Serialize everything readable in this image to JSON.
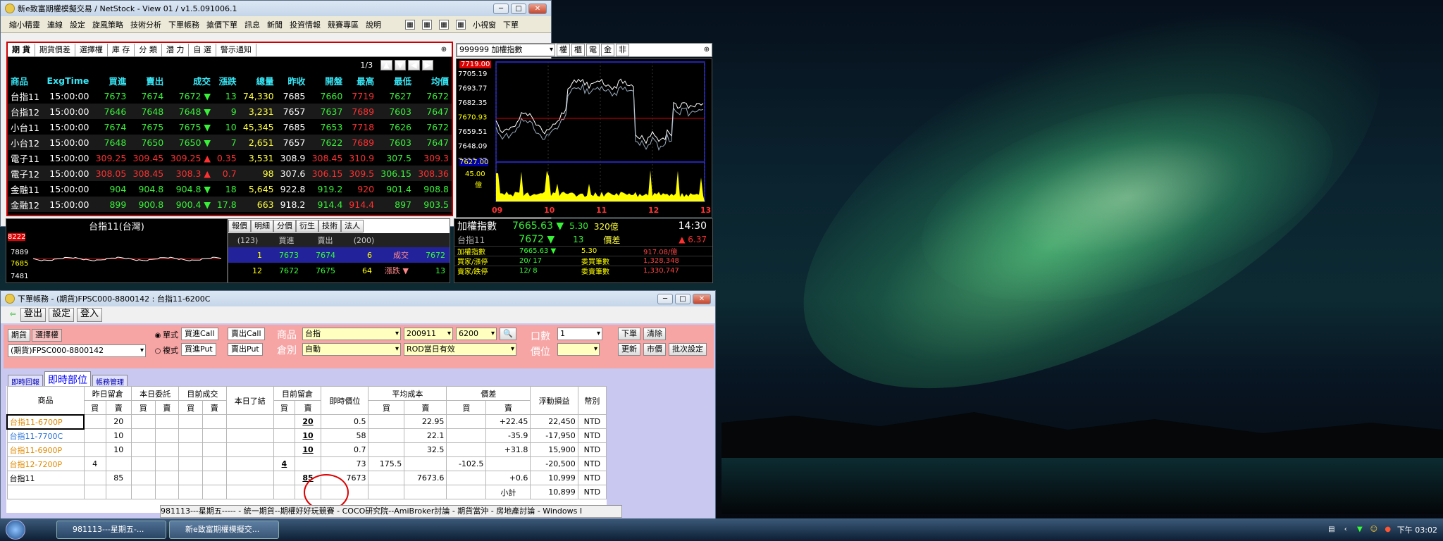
{
  "main_window": {
    "title": "新e致富期權模擬交易 / NetStock - View 01 / v1.5.091006.1",
    "menu": [
      "縮小精靈",
      "連線",
      "設定",
      "旋風策略",
      "技術分析",
      "下單帳務",
      "搶價下單",
      "訊息",
      "新聞",
      "投資情報",
      "競賽專區",
      "說明"
    ],
    "menu_right": [
      "小視窗",
      "下單"
    ],
    "tabs": [
      "期 貨",
      "期貨價差",
      "選擇權",
      "庫 存",
      "分 類",
      "潛 力",
      "自 選",
      "警示通知"
    ],
    "page_indicator": "1/3",
    "headers": [
      "商品",
      "ExgTime",
      "買進",
      "賣出",
      "成交",
      "漲跌",
      "總量",
      "昨收",
      "開盤",
      "最高",
      "最低",
      "均價"
    ],
    "rows": [
      {
        "cells": [
          "台指11",
          "15:00:00",
          "7673",
          "7674",
          "7672 ▼",
          "13",
          "74,330",
          "7685",
          "7660",
          "7719",
          "7627",
          "7672"
        ],
        "tone": "down"
      },
      {
        "cells": [
          "台指12",
          "15:00:00",
          "7646",
          "7648",
          "7648 ▼",
          "9",
          "3,231",
          "7657",
          "7637",
          "7689",
          "7603",
          "7647"
        ],
        "tone": "down"
      },
      {
        "cells": [
          "小台11",
          "15:00:00",
          "7674",
          "7675",
          "7675 ▼",
          "10",
          "45,345",
          "7685",
          "7653",
          "7718",
          "7626",
          "7672"
        ],
        "tone": "down"
      },
      {
        "cells": [
          "小台12",
          "15:00:00",
          "7648",
          "7650",
          "7650 ▼",
          "7",
          "2,651",
          "7657",
          "7622",
          "7689",
          "7603",
          "7647"
        ],
        "tone": "down"
      },
      {
        "cells": [
          "電子11",
          "15:00:00",
          "309.25",
          "309.45",
          "309.25 ▲",
          "0.35",
          "3,531",
          "308.9",
          "308.45",
          "310.9",
          "307.5",
          "309.3"
        ],
        "tone": "up"
      },
      {
        "cells": [
          "電子12",
          "15:00:00",
          "308.05",
          "308.45",
          "308.3 ▲",
          "0.7",
          "98",
          "307.6",
          "306.15",
          "309.5",
          "306.15",
          "308.36"
        ],
        "tone": "up"
      },
      {
        "cells": [
          "金融11",
          "15:00:00",
          "904",
          "904.8",
          "904.8 ▼",
          "18",
          "5,645",
          "922.8",
          "919.2",
          "920",
          "901.4",
          "908.8"
        ],
        "tone": "down"
      },
      {
        "cells": [
          "金融12",
          "15:00:00",
          "899",
          "900.8",
          "900.4 ▼",
          "17.8",
          "663",
          "918.2",
          "914.4",
          "914.4",
          "897",
          "903.5"
        ],
        "tone": "down"
      }
    ],
    "index_select": "999999 加權指數",
    "index_buttons": [
      "權",
      "櫃",
      "電",
      "金",
      "非"
    ],
    "index_chart": {
      "high_label": "7719.00",
      "ticks": [
        "7705.19",
        "7693.77",
        "7682.35",
        "7670.93",
        "7659.51",
        "7648.09",
        "7636.67"
      ],
      "low_label": "7627.00",
      "vol_label": "45.00",
      "vol_unit": "億",
      "x_labels": [
        "09",
        "10",
        "11",
        "12",
        "13"
      ]
    },
    "mini_chart": {
      "title": "台指11(台灣)",
      "top": "8222",
      "ticks": [
        "7889",
        "7685",
        "7481"
      ]
    },
    "detail_tabs": [
      "報價",
      "明細",
      "分價",
      "衍生",
      "技術",
      "法人"
    ],
    "detail_head": [
      "(123)",
      "買進",
      "賣出",
      "(200)"
    ],
    "detail_rows": [
      [
        "1",
        "7673",
        "7674",
        "6",
        "成交",
        "7672"
      ],
      [
        "12",
        "7672",
        "7675",
        "64",
        "漲跌 ▼",
        "13"
      ]
    ],
    "index_panel": {
      "name1": "加權指數",
      "val1": "7665.63 ▼",
      "chg1": "5.30",
      "vol1": "320億",
      "time": "14:30",
      "name2": "台指11",
      "val2": "7672 ▼",
      "chg2": "13",
      "basis_label": "價差",
      "basis": "▲ 6.37",
      "sub": [
        [
          "加權指數",
          "7665.63 ▼",
          "5.30",
          "917.08/億"
        ],
        [
          "買家/漲停",
          "20/ 17",
          "委買筆數",
          "1,328,348"
        ],
        [
          "賣家/跌停",
          "12/ 8",
          "委賣筆數",
          "1,330,747"
        ]
      ]
    }
  },
  "order_window": {
    "title": "下單帳務 - (期貨)FPSC000-8800142 : 台指11-6200C",
    "toolbar": [
      "登出",
      "設定",
      "登入"
    ],
    "tab1": "期貨",
    "tab2": "選擇權",
    "account": "(期貨)FPSC000-8800142",
    "single": "單式",
    "combo": "複式",
    "buy_call": "買進Call",
    "sell_call": "賣出Call",
    "buy_put": "買進Put",
    "sell_put": "賣出Put",
    "product_label": "商品",
    "product": "台指",
    "month": "200911",
    "strike": "6200",
    "position_label": "倉別",
    "position": "自動",
    "tif": "ROD當日有效",
    "qty_label": "口數",
    "qty": "1",
    "price_label": "價位",
    "btn_order": "下單",
    "btn_clear": "清除",
    "btn_update": "更新",
    "btn_market": "市價",
    "btn_batch": "批次設定",
    "subtabs": [
      "即時回報",
      "即時部位",
      "帳務管理"
    ],
    "pos_head_top": [
      "商品",
      "昨日留倉",
      "本日委託",
      "目前成交",
      "本日了結",
      "目前留倉",
      "即時價位",
      "平均成本",
      "價差",
      "浮動損益",
      "幣別"
    ],
    "buy": "買",
    "sell": "賣",
    "pos_rows": [
      {
        "name": "台指11-6700P",
        "cls": "o",
        "y_s": "20",
        "cur_s": "20",
        "price": "0.5",
        "cost_s": "22.95",
        "diff_s": "+22.45",
        "pnl": "22,450",
        "cur": "NTD"
      },
      {
        "name": "台指11-7700C",
        "cls": "b",
        "y_s": "10",
        "cur_s": "10",
        "price": "58",
        "cost_s": "22.1",
        "diff_s": "-35.9",
        "pnl": "-17,950",
        "cur": "NTD"
      },
      {
        "name": "台指11-6900P",
        "cls": "o",
        "y_s": "10",
        "cur_s": "10",
        "price": "0.7",
        "cost_s": "32.5",
        "diff_s": "+31.8",
        "pnl": "15,900",
        "cur": "NTD"
      },
      {
        "name": "台指12-7200P",
        "cls": "o",
        "y_b": "4",
        "cur_b": "4",
        "price": "73",
        "cost_b": "175.5",
        "diff_b": "-102.5",
        "pnl": "-20,500",
        "cur": "NTD"
      },
      {
        "name": "台指11",
        "cls": "k",
        "y_s": "85",
        "cur_s": "85",
        "price": "7673",
        "cost_s": "7673.6",
        "diff_s": "+0.6",
        "pnl": "10,999",
        "cur": "NTD"
      }
    ],
    "subtotal_label": "小計",
    "subtotal": "10,899",
    "cur": "NTD",
    "ticker": "981113---星期五----- - 統一期貨--期權好好玩競賽 - COCO研究院--AmiBroker討論 - 期貨當沖 - 房地產討論 - Windows I"
  },
  "taskbar": {
    "items": [
      "981113---星期五-...",
      "新e致富期權模擬交..."
    ],
    "clock": "下午 03:02"
  }
}
